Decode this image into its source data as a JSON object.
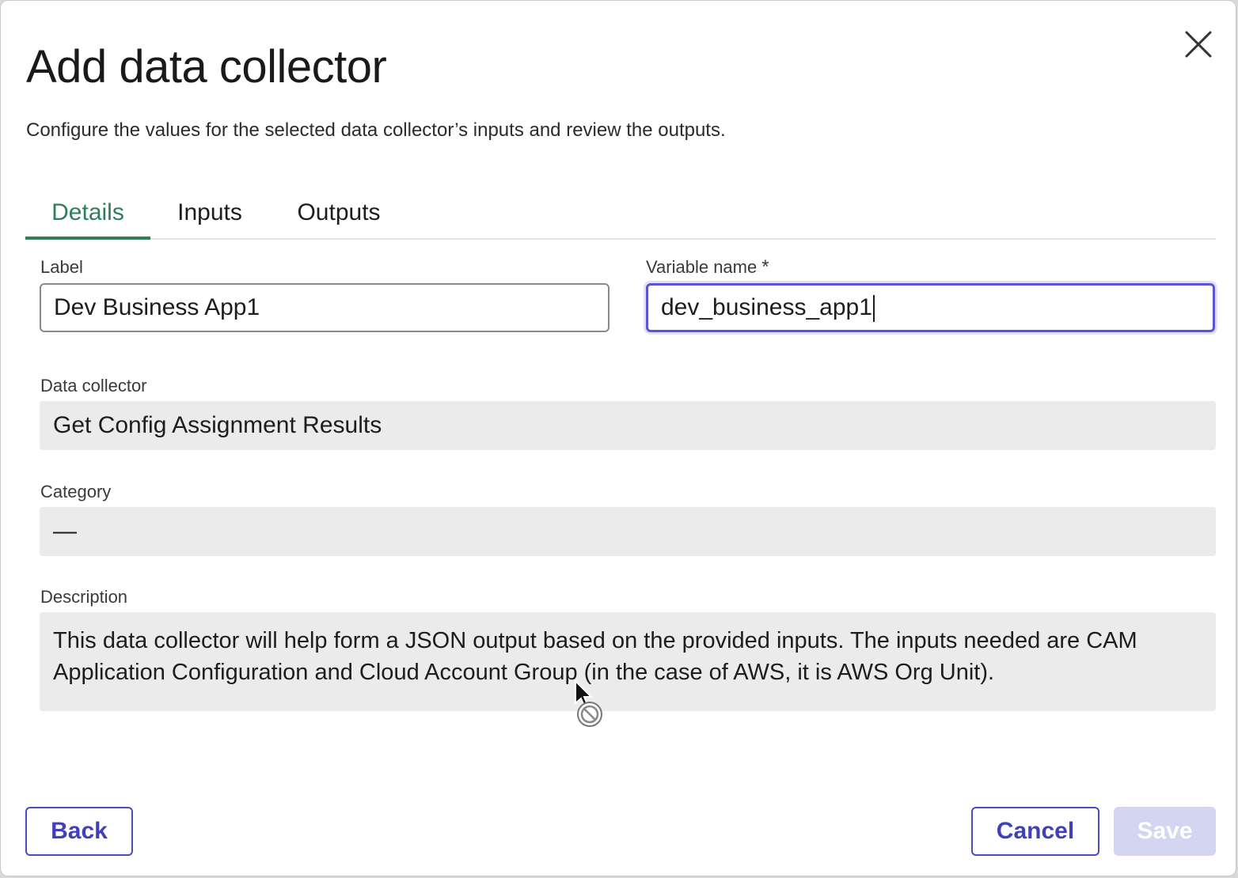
{
  "dialog": {
    "title": "Add data collector",
    "subtitle": "Configure the values for the selected data collector’s inputs and review the outputs.",
    "close_icon": "close-icon"
  },
  "tabs": [
    {
      "label": "Details",
      "active": true
    },
    {
      "label": "Inputs",
      "active": false
    },
    {
      "label": "Outputs",
      "active": false
    }
  ],
  "fields": {
    "label": {
      "label": "Label",
      "value": "Dev Business App1"
    },
    "variable_name": {
      "label": "Variable name",
      "required_mark": "*",
      "value": "dev_business_app1"
    },
    "data_collector": {
      "label": "Data collector",
      "value": "Get Config Assignment Results"
    },
    "category": {
      "label": "Category",
      "value": "—"
    },
    "description": {
      "label": "Description",
      "value": "This data collector will help form a JSON output based on the provided inputs. The inputs needed are CAM Application Configuration and Cloud Account Group (in the case of AWS, it is AWS Org Unit)."
    }
  },
  "buttons": {
    "back": "Back",
    "cancel": "Cancel",
    "save": "Save"
  },
  "colors": {
    "tab_active": "#2e7d5b",
    "focus_border": "#5a55d6",
    "primary": "#4040b8",
    "disabled_bg": "#d4d6f1"
  }
}
